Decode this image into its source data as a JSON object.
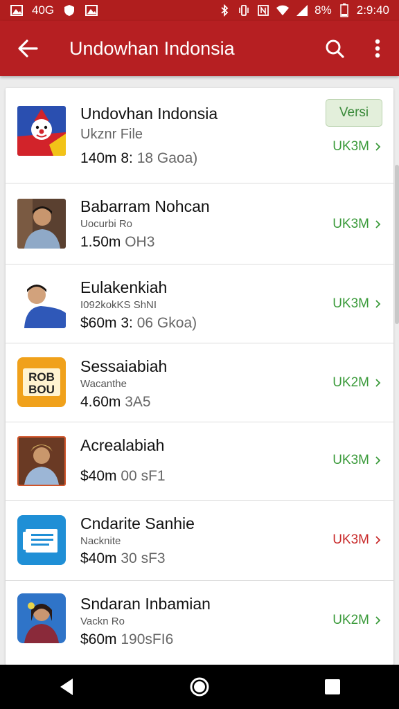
{
  "status_bar": {
    "left_text": "40G",
    "battery": "8%",
    "time": "2:9:40"
  },
  "app_bar": {
    "title": "Undowhan Indonsia"
  },
  "list": {
    "items": [
      {
        "name": "Undovhan Indonsia",
        "subtitle": "Ukznr File",
        "meta_strong": "140m 8:",
        "meta_soft": "18 Gaoa)",
        "size": "UK3M",
        "badge": "Versi",
        "thumb": "clown-icon"
      },
      {
        "name": "Babarram Nohcan",
        "subtitle": "Uocurbi Ro",
        "meta_strong": "1.50m",
        "meta_soft": "OH3",
        "size": "UK3M",
        "thumb": "person-photo"
      },
      {
        "name": "Eulakenkiah",
        "subtitle": "I092kokKS ShNI",
        "meta_strong": "$60m 3:",
        "meta_soft": "06 Gkoa)",
        "size": "UK3M",
        "thumb": "person-photo"
      },
      {
        "name": "Sessaiabiah",
        "subtitle": "Wacanthe",
        "meta_strong": "4.60m",
        "meta_soft": "3A5",
        "size": "UK2M",
        "thumb": "bou-logo"
      },
      {
        "name": "Acrealabiah",
        "subtitle": "",
        "meta_strong": "$40m",
        "meta_soft": "00 sF1",
        "size": "UK3M",
        "thumb": "person-photo"
      },
      {
        "name": "Cndarite Sanhie",
        "subtitle": "Nacknite",
        "meta_strong": "$40m",
        "meta_soft": "30 sF3",
        "size": "UK3M",
        "size_color": "#c82a2a",
        "thumb": "document-icon"
      },
      {
        "name": "Sndaran Inbamian",
        "subtitle": "Vackn Ro",
        "meta_strong": "$60m",
        "meta_soft": "190sFI6",
        "size": "UK2M",
        "thumb": "person-photo"
      }
    ]
  },
  "colors": {
    "app_bar": "#b61f22",
    "status_bar": "#b01e1e",
    "size_green": "#3a9a3a",
    "size_red": "#c82a2a"
  }
}
